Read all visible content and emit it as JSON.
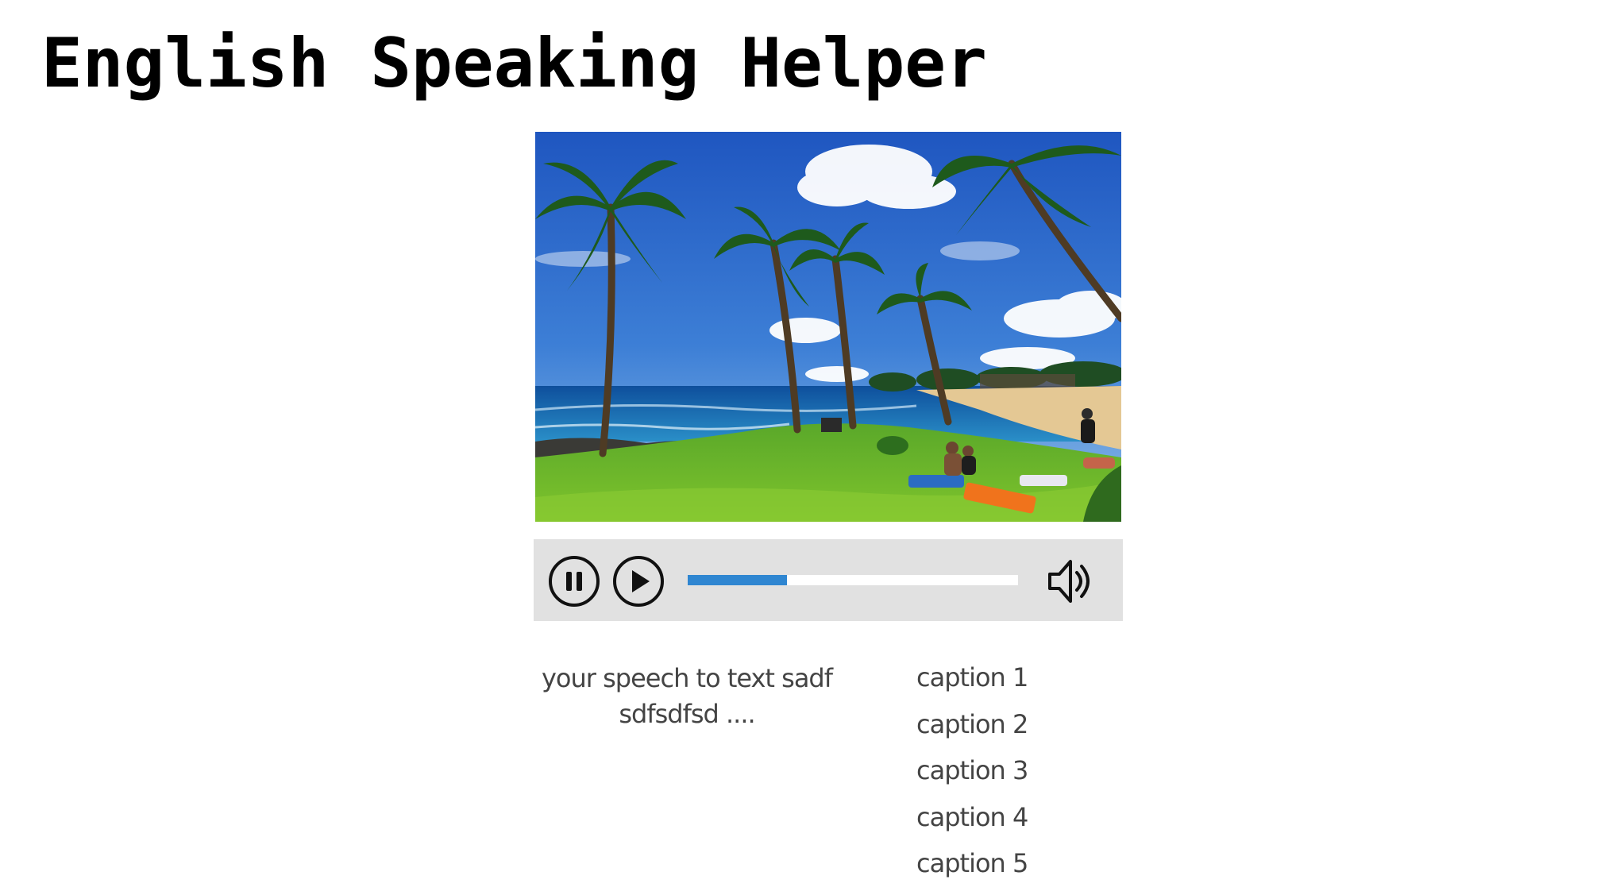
{
  "page": {
    "title": "English Speaking Helper"
  },
  "video": {
    "scene": "beach-palm-trees-image"
  },
  "player": {
    "progress_fraction": 0.3,
    "icons": {
      "pause": "pause-circle-icon",
      "play": "play-circle-icon",
      "volume": "speaker-volume-icon"
    },
    "progress_color": "#2f86d1",
    "bar_color": "#e1e1e1"
  },
  "speech": {
    "text": "your speech to text sadf sdfsdfsd ...."
  },
  "captions": [
    "caption 1",
    "caption 2",
    "caption 3",
    "caption 4",
    "caption 5"
  ]
}
